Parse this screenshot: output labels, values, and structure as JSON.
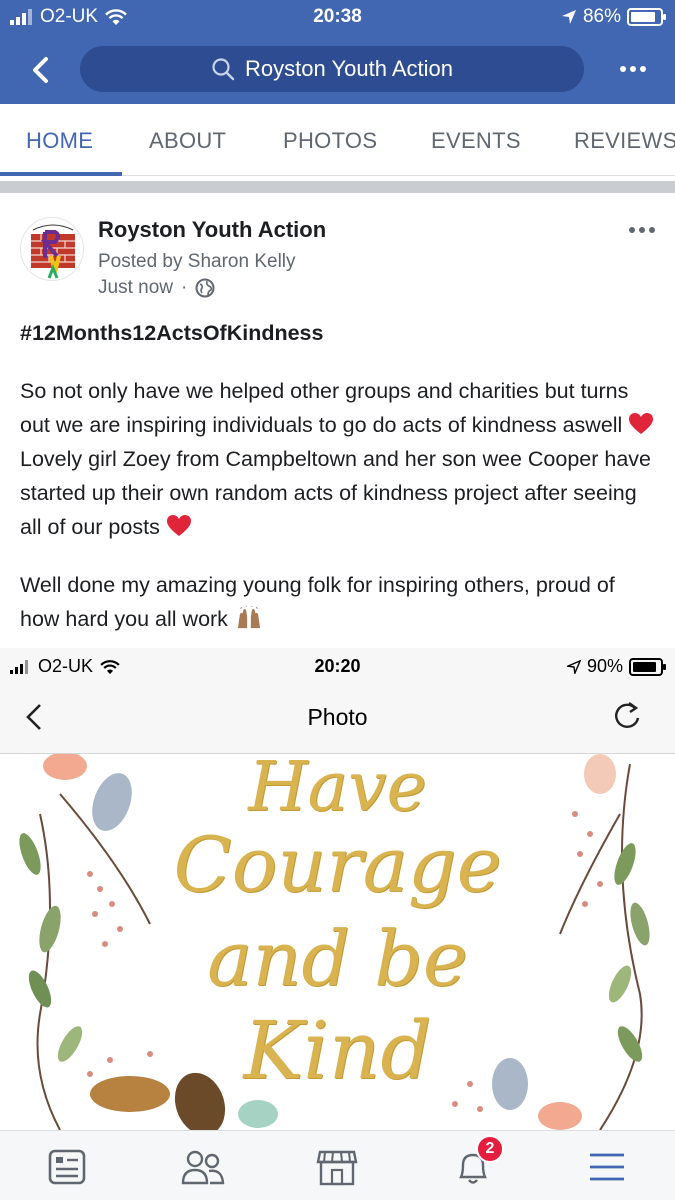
{
  "status_bar": {
    "carrier": "O2-UK",
    "time": "20:38",
    "battery": "86%",
    "battery_level": 0.86
  },
  "navbar": {
    "search_text": "Royston Youth Action"
  },
  "tabs": [
    {
      "label": "HOME",
      "active": true
    },
    {
      "label": "ABOUT",
      "active": false
    },
    {
      "label": "PHOTOS",
      "active": false
    },
    {
      "label": "EVENTS",
      "active": false
    },
    {
      "label": "REVIEWS",
      "active": false
    }
  ],
  "post": {
    "page_name": "Royston Youth Action",
    "posted_by": "Posted by Sharon Kelly",
    "time": "Just now",
    "hashtag": "#12Months12ActsOfKindness",
    "para1_a": "So not only have we helped other groups and charities but turns out we are inspiring individuals to go do acts of kindness aswell",
    "para1_b": "Lovely girl Zoey from Campbeltown and her son wee Cooper have started up their own random acts of kindness project after seeing all of our posts",
    "para2": "Well done my amazing young folk for inspiring others, proud of how hard you all work"
  },
  "embedded_screenshot": {
    "carrier": "O2-UK",
    "time": "20:20",
    "battery": "90%",
    "battery_level": 0.9,
    "title": "Photo",
    "artwork_lines": [
      "Have",
      "Courage",
      "and be",
      "Kind"
    ]
  },
  "bottom_bar": {
    "notification_count": "2",
    "icons": [
      "news-feed-icon",
      "friends-icon",
      "marketplace-icon",
      "notifications-icon",
      "menu-icon"
    ]
  },
  "colors": {
    "brand": "#4267b2",
    "badge": "#e41e3f",
    "heart": "#e0243a"
  }
}
